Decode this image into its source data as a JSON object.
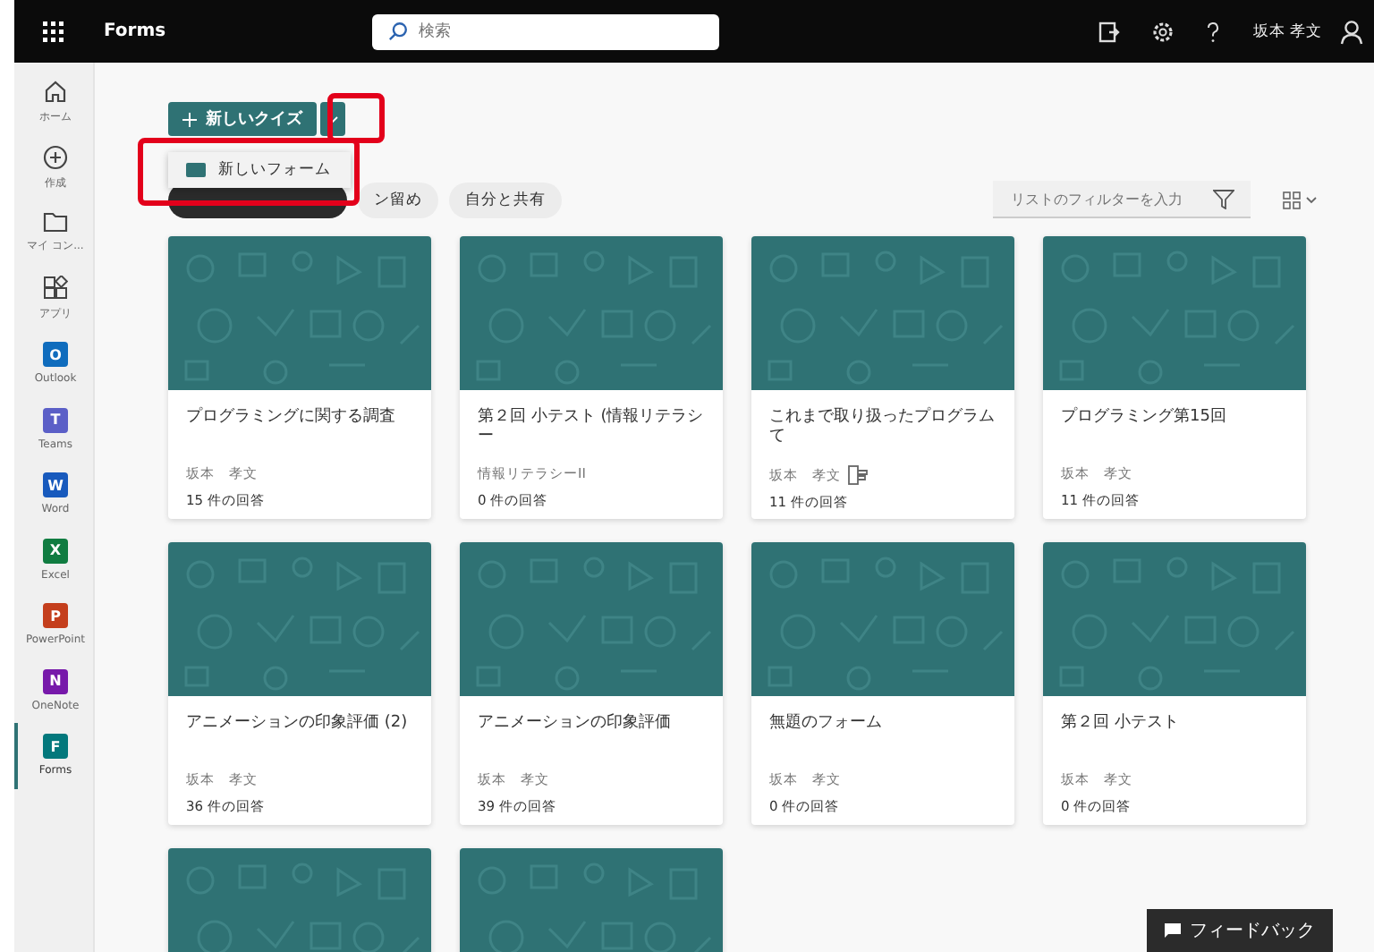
{
  "top_bar": {
    "app_name": "Forms",
    "search": {
      "placeholder": "検索"
    },
    "user_name": "坂本 孝文"
  },
  "rail": [
    {
      "label": "ホーム",
      "kind": "home",
      "selected": false
    },
    {
      "label": "作成",
      "kind": "create",
      "selected": false
    },
    {
      "label": "マイ コン...",
      "kind": "folder",
      "selected": false
    },
    {
      "label": "アプリ",
      "kind": "apps",
      "selected": false
    },
    {
      "label": "Outlook",
      "kind": "app",
      "letter": "O",
      "color": "#0f6cbd",
      "selected": false
    },
    {
      "label": "Teams",
      "kind": "app",
      "letter": "T",
      "color": "#5b5fc7",
      "selected": false
    },
    {
      "label": "Word",
      "kind": "app",
      "letter": "W",
      "color": "#185abd",
      "selected": false
    },
    {
      "label": "Excel",
      "kind": "app",
      "letter": "X",
      "color": "#107c41",
      "selected": false
    },
    {
      "label": "PowerPoint",
      "kind": "app",
      "letter": "P",
      "color": "#c43e1c",
      "selected": false
    },
    {
      "label": "OneNote",
      "kind": "app",
      "letter": "N",
      "color": "#7719aa",
      "selected": false
    },
    {
      "label": "Forms",
      "kind": "app",
      "letter": "F",
      "color": "#03787c",
      "selected": true
    }
  ],
  "new_button": {
    "label": "新しいクイズ"
  },
  "dropdown_menu": {
    "items": [
      {
        "label": "新しいフォーム"
      }
    ]
  },
  "chips": [
    {
      "selected": true
    },
    {
      "label": "ン留め",
      "selected": false
    },
    {
      "label": "自分と共有",
      "selected": false
    }
  ],
  "filter": {
    "placeholder": "リストのフィルターを入力"
  },
  "cards": [
    {
      "kind": "full",
      "title": "プログラミングに関する調査",
      "owner": "坂本　孝文",
      "responses": "15 件の回答",
      "shared": false
    },
    {
      "kind": "full",
      "title": "第２回 小テスト (情報リテラシー",
      "owner": "情報リテラシーII",
      "responses": "0 件の回答",
      "shared": false
    },
    {
      "kind": "full",
      "title": "これまで取り扱ったプログラムて",
      "owner": "坂本　孝文",
      "responses": "11 件の回答",
      "shared": true
    },
    {
      "kind": "full",
      "title": "プログラミング第15回",
      "owner": "坂本　孝文",
      "responses": "11 件の回答",
      "shared": false
    },
    {
      "kind": "full",
      "title": "アニメーションの印象評価 (2)",
      "owner": "坂本　孝文",
      "responses": "36 件の回答",
      "shared": false
    },
    {
      "kind": "full",
      "title": "アニメーションの印象評価",
      "owner": "坂本　孝文",
      "responses": "39 件の回答",
      "shared": false
    },
    {
      "kind": "full",
      "title": "無題のフォーム",
      "owner": "坂本　孝文",
      "responses": "0 件の回答",
      "shared": false
    },
    {
      "kind": "full",
      "title": "第２回 小テスト",
      "owner": "坂本　孝文",
      "responses": "0 件の回答",
      "shared": false
    },
    {
      "kind": "partial"
    },
    {
      "kind": "partial"
    }
  ],
  "feedback_button": {
    "label": "フィードバック"
  }
}
